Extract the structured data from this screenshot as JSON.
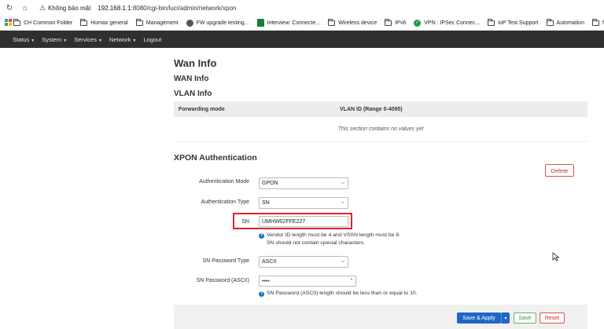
{
  "browser": {
    "security_label": "Không bảo mật",
    "url_host": "192.168.1.1",
    "url_rest": ":8080/cgi-bin/luci/admin/network/xpon",
    "bookmarks": [
      {
        "label": "CH Common Folder",
        "icon": "folder-icon"
      },
      {
        "label": "Humax general",
        "icon": "folder-icon"
      },
      {
        "label": "Management",
        "icon": "folder-icon"
      },
      {
        "label": "FW upgrade testing...",
        "icon": "globe-icon"
      },
      {
        "label": "Interview: Connecte...",
        "icon": "sheet-icon"
      },
      {
        "label": "Wireless device",
        "icon": "folder-icon"
      },
      {
        "label": "IPv6",
        "icon": "folder-icon"
      },
      {
        "label": "VPN : IPSec Connec...",
        "icon": "vpn-icon"
      },
      {
        "label": "IoP Test Support",
        "icon": "folder-icon"
      },
      {
        "label": "Automation",
        "icon": "folder-icon"
      },
      {
        "label": "NW SW Verific",
        "icon": "folder-icon"
      }
    ]
  },
  "nav": {
    "items": [
      {
        "label": "Status",
        "has_caret": true
      },
      {
        "label": "System",
        "has_caret": true
      },
      {
        "label": "Services",
        "has_caret": true
      },
      {
        "label": "Network",
        "has_caret": true
      },
      {
        "label": "Logout",
        "has_caret": false
      }
    ]
  },
  "page": {
    "title": "Wan Info",
    "wan_info_heading": "WAN Info",
    "vlan_info_heading": "VLAN Info",
    "vlan_table": {
      "columns": [
        "Forwarding mode",
        "VLAN ID (Range 0-4095)"
      ],
      "empty_text": "This section contains no values yet"
    },
    "xpon_heading": "XPON Authentication",
    "delete_label": "Delete",
    "form": {
      "auth_mode_label": "Authentication Mode",
      "auth_mode_value": "GPON",
      "auth_type_label": "Authentication Type",
      "auth_type_value": "SN",
      "sn_label": "SN",
      "sn_value": "UMHW02FFE227",
      "sn_hint_line1": "Vendor ID length must be 4 and VSSN length must be 8.",
      "sn_hint_line2": "SN should not contain special characters.",
      "sn_pw_type_label": "SN Password Type",
      "sn_pw_type_value": "ASCII",
      "sn_pw_label": "SN Password (ASCII)",
      "sn_pw_value": "••••",
      "sn_pw_hint": "SN Password (ASCII) length should be less than or equal to 10."
    },
    "actions": {
      "save_apply_label": "Save & Apply",
      "save_label": "Save",
      "reset_label": "Reset"
    }
  },
  "colors": {
    "navbar": "#2f2f2f",
    "primary": "#1f66c6",
    "danger": "#d9534f",
    "success": "#5cb85c",
    "highlight": "#d6262f"
  }
}
